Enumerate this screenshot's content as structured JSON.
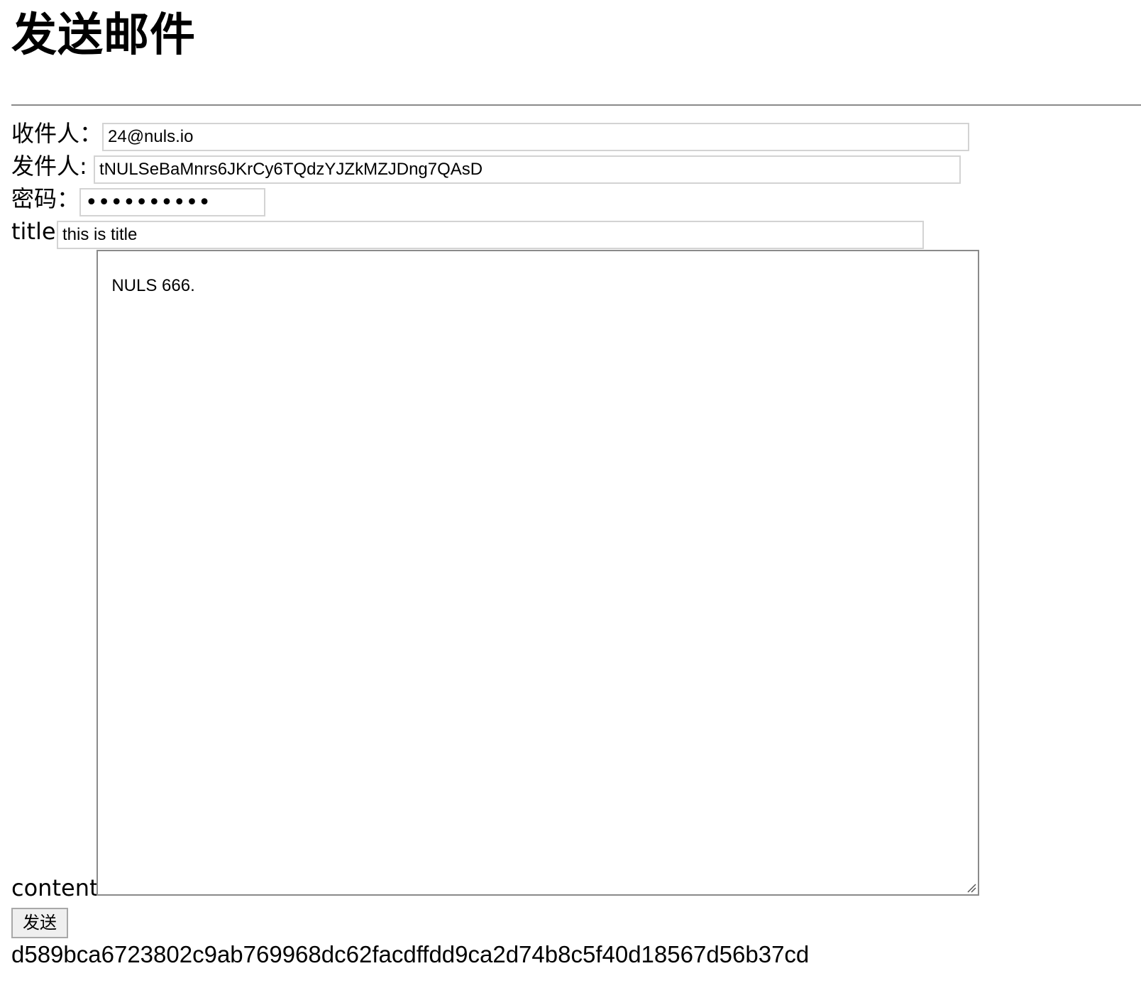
{
  "page": {
    "title": "发送邮件"
  },
  "form": {
    "recipient_label": "收件人：",
    "recipient_value": "24@nuls.io",
    "sender_label": "发件人:",
    "sender_value": "tNULSeBaMnrs6JKrCy6TQdzYJZkMZJDng7QAsD",
    "password_label": "密码：",
    "password_mask": "••••••••••",
    "title_label": "title:",
    "title_value": "this is title",
    "content_label": "content:",
    "content_value": "NULS 666."
  },
  "actions": {
    "send_label": "发送"
  },
  "result": {
    "tx_hash": "d589bca6723802c9ab769968dc62facdffdd9ca2d74b8c5f40d18567d56b37cd"
  },
  "colors": {
    "divider": "#8a8a8a",
    "input_border": "#d3d3d3",
    "textarea_border": "#8a8a8a",
    "button_bg": "#efefef"
  }
}
